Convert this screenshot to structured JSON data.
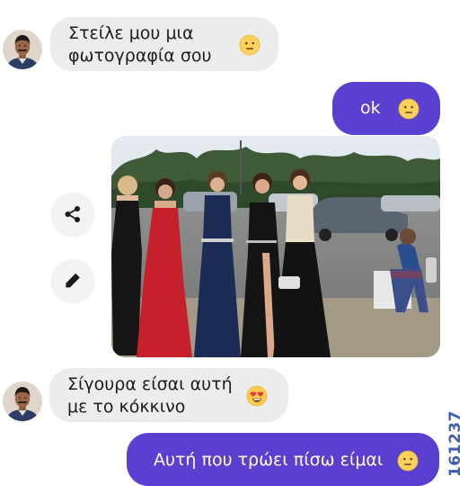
{
  "messages": [
    {
      "sender": "contact",
      "lines": [
        "Στείλε μου μια",
        "φωτογραφία σου"
      ],
      "emoji": "neutral-face"
    },
    {
      "sender": "me",
      "text": "ok",
      "emoji": "neutral-face"
    },
    {
      "sender": "me",
      "type": "photo",
      "description_icon": "photo-attachment"
    },
    {
      "sender": "contact",
      "lines": [
        "Σίγουρα είσαι αυτή",
        "με το κόκκινο"
      ],
      "emoji": "heart-eyes-face"
    },
    {
      "sender": "me",
      "text": "Αυτή που τρώει πίσω είμαι",
      "emoji": "neutral-face"
    }
  ],
  "photo_actions": [
    {
      "name": "share",
      "icon": "share-icon"
    },
    {
      "name": "edit",
      "icon": "pencil-icon"
    }
  ],
  "watermark": "161237",
  "colors": {
    "outgoing_bubble": "#5a3fd1",
    "incoming_bubble": "#ececec",
    "background": "#ffffff",
    "watermark": "#3d5fb0"
  }
}
